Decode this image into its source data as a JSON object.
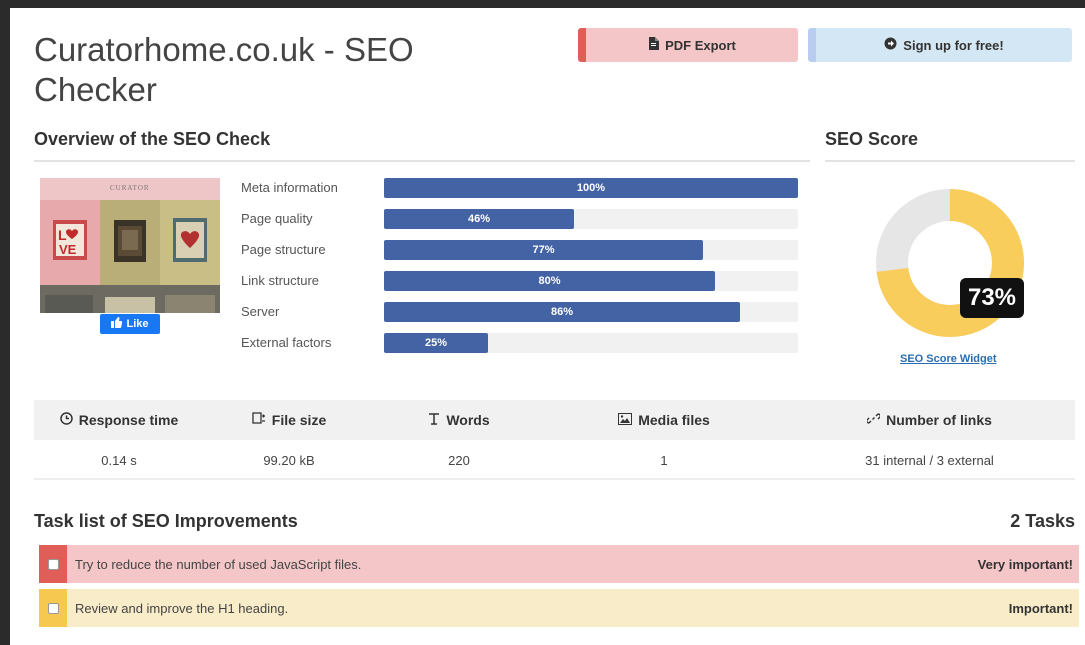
{
  "page": {
    "title": "Curatorhome.co.uk - SEO Checker"
  },
  "toolbar": {
    "pdf_label": "PDF Export",
    "signup_label": "Sign up for free!"
  },
  "overview": {
    "heading": "Overview of the SEO Check",
    "thumbnail": {
      "site_name": "CURATOR",
      "like_label": "Like"
    },
    "metrics": [
      {
        "label": "Meta information",
        "percent": 100,
        "percent_text": "100%"
      },
      {
        "label": "Page quality",
        "percent": 46,
        "percent_text": "46%"
      },
      {
        "label": "Page structure",
        "percent": 77,
        "percent_text": "77%"
      },
      {
        "label": "Link structure",
        "percent": 80,
        "percent_text": "80%"
      },
      {
        "label": "Server",
        "percent": 86,
        "percent_text": "86%"
      },
      {
        "label": "External factors",
        "percent": 25,
        "percent_text": "25%"
      }
    ]
  },
  "score": {
    "heading": "SEO Score",
    "value": 73,
    "value_text": "73%",
    "widget_link": "SEO Score Widget",
    "colors": {
      "fill": "#f9cd5b",
      "track": "#e6e6e6"
    }
  },
  "stats": {
    "headers": [
      "Response time",
      "File size",
      "Words",
      "Media files",
      "Number of links"
    ],
    "icons": [
      "clock-icon",
      "file-size-icon",
      "text-icon",
      "image-icon",
      "link-icon"
    ],
    "values": [
      "0.14 s",
      "99.20 kB",
      "220",
      "1",
      "31 internal / 3 external"
    ]
  },
  "tasks": {
    "heading": "Task list of SEO Improvements",
    "count_text": "2 Tasks",
    "items": [
      {
        "text": "Try to reduce the number of used JavaScript files.",
        "priority": "Very important!",
        "color": "#e05d58"
      },
      {
        "text": "Review and improve the H1 heading.",
        "priority": "Important!",
        "color": "#f7c84f"
      }
    ]
  },
  "colors": {
    "accent_bar": "#4463a5",
    "facebook": "#1877f2"
  }
}
